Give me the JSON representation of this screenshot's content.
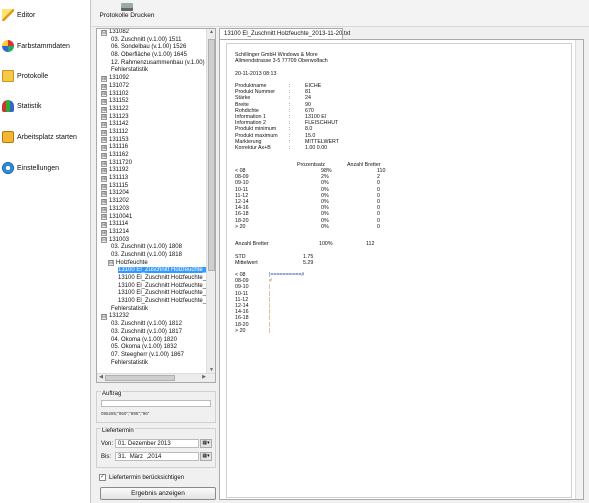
{
  "nav": {
    "items": [
      {
        "label": "Editor",
        "icon": "pencil-icon"
      },
      {
        "label": "Farbstammdaten",
        "icon": "palette-icon"
      },
      {
        "label": "Protokolle",
        "icon": "folder-icon"
      },
      {
        "label": "Statistik",
        "icon": "chart-icon"
      },
      {
        "label": "Arbeitsplatz starten",
        "icon": "briefcase-icon"
      },
      {
        "label": "Einstellungen",
        "icon": "settings-icon"
      }
    ]
  },
  "toolbar": {
    "print_label": "Protokolle Drucken",
    "print_icon": "printer-icon"
  },
  "tree": {
    "rows": [
      {
        "label": "131082",
        "exp": "⊟",
        "indent": 0
      },
      {
        "label": "03. Zuschnitt (v.1.00) 1511",
        "exp": "",
        "indent": 1
      },
      {
        "label": "06. Sondelbau (v.1.00) 1526",
        "exp": "",
        "indent": 1
      },
      {
        "label": "08. Oberfläche (v.1.00) 1645",
        "exp": "",
        "indent": 1
      },
      {
        "label": "12. Rahmenzusammenbau (v.1.00) 1",
        "exp": "",
        "indent": 1
      },
      {
        "label": "Fehlerstatistik",
        "exp": "",
        "indent": 1
      },
      {
        "label": "131092",
        "exp": "⊞",
        "indent": 0
      },
      {
        "label": "131072",
        "exp": "⊞",
        "indent": 0
      },
      {
        "label": "131102",
        "exp": "⊞",
        "indent": 0
      },
      {
        "label": "131152",
        "exp": "⊞",
        "indent": 0
      },
      {
        "label": "131122",
        "exp": "⊞",
        "indent": 0
      },
      {
        "label": "131123",
        "exp": "⊞",
        "indent": 0
      },
      {
        "label": "131142",
        "exp": "⊞",
        "indent": 0
      },
      {
        "label": "131112",
        "exp": "⊞",
        "indent": 0
      },
      {
        "label": "131153",
        "exp": "⊞",
        "indent": 0
      },
      {
        "label": "131116",
        "exp": "⊞",
        "indent": 0
      },
      {
        "label": "131162",
        "exp": "⊞",
        "indent": 0
      },
      {
        "label": "1311720",
        "exp": "⊞",
        "indent": 0
      },
      {
        "label": "131192",
        "exp": "⊞",
        "indent": 0
      },
      {
        "label": "131113",
        "exp": "⊞",
        "indent": 0
      },
      {
        "label": "131115",
        "exp": "⊞",
        "indent": 0
      },
      {
        "label": "131204",
        "exp": "⊞",
        "indent": 0
      },
      {
        "label": "131202",
        "exp": "⊞",
        "indent": 0
      },
      {
        "label": "131203",
        "exp": "⊞",
        "indent": 0
      },
      {
        "label": "1310041",
        "exp": "⊞",
        "indent": 0
      },
      {
        "label": "131114",
        "exp": "⊞",
        "indent": 0
      },
      {
        "label": "131214",
        "exp": "⊞",
        "indent": 0
      },
      {
        "label": "131003",
        "exp": "⊟",
        "indent": 0
      },
      {
        "label": "03. Zuschnitt (v.1.00) 1808",
        "exp": "",
        "indent": 1
      },
      {
        "label": "03. Zuschnitt (v.1.00) 1818",
        "exp": "",
        "indent": 1
      },
      {
        "label": "Holzfeuchte",
        "exp": "⊟",
        "indent": 1
      },
      {
        "label": "13100 El_Zuschnitt Holzfeuchte_",
        "exp": "",
        "indent": 2,
        "selected": true
      },
      {
        "label": "13100 El_Zuschnitt Holzfeuchte_",
        "exp": "",
        "indent": 2
      },
      {
        "label": "13100 El_Zuschnitt Holzfeuchte_",
        "exp": "",
        "indent": 2
      },
      {
        "label": "13100 El_Zuschnitt Holzfeuchte_",
        "exp": "",
        "indent": 2
      },
      {
        "label": "13100 El_Zuschnitt Holzfeuchte_",
        "exp": "",
        "indent": 2
      },
      {
        "label": "Fehlerstatistik",
        "exp": "",
        "indent": 1
      },
      {
        "label": "131232",
        "exp": "⊟",
        "indent": 0
      },
      {
        "label": "03. Zuschnitt (v.1.00) 1812",
        "exp": "",
        "indent": 1
      },
      {
        "label": "03. Zuschnitt (v.1.00) 1817",
        "exp": "",
        "indent": 1
      },
      {
        "label": "04. Okoma (v.1.00) 1820",
        "exp": "",
        "indent": 1
      },
      {
        "label": "05. Okoma (v.1.00) 1832",
        "exp": "",
        "indent": 1
      },
      {
        "label": "07. Steegherr (v.1.00) 1867",
        "exp": "",
        "indent": 1
      },
      {
        "label": "Fehlerstatistik",
        "exp": "",
        "indent": 1
      }
    ]
  },
  "auftrag": {
    "title": "Auftrag",
    "input_value": "",
    "value_text": "095285;\"950\";\"895\";\"96\""
  },
  "liefertermin": {
    "title": "Liefertermin",
    "von_label": "Von:",
    "von_day": "01.",
    "von_month": "Dezember",
    "von_year": "2013",
    "bis_label": "Bis:",
    "bis_day": "31.",
    "bis_month": "März",
    "bis_year": "2014"
  },
  "checkbox_label": "Liefertermin berücksichtigen",
  "checkbox_checked": true,
  "show_button_label": "Ergebnis anzeigen",
  "report": {
    "tab_label": "13100 El_Zuschnitt Holzfeuchte_2013-11-20.txt",
    "company": "Schillinger GmbH Windows & More",
    "address": "Allmendstrasse 3-5 77709 Oberwolfach",
    "datetime": "20-11-2013  08:13",
    "fields": [
      {
        "k": "Produktname",
        "v": "EICHE"
      },
      {
        "k": "Produkt Nummer",
        "v": "81"
      },
      {
        "k": "Stärke",
        "v": "24"
      },
      {
        "k": "Breite",
        "v": "90"
      },
      {
        "k": "Rohdichte",
        "v": "670"
      },
      {
        "k": "Information 1",
        "v": "13100 El"
      },
      {
        "k": "Information 2",
        "v": "FLEISCHHUT"
      },
      {
        "k": "Produkt minimum",
        "v": "8.0"
      },
      {
        "k": "Produkt maximum",
        "v": "15.0"
      },
      {
        "k": "Markierung",
        "v": "MITTELWERT"
      },
      {
        "k": "Korrektur Ax+B",
        "v": "1.00   0.00"
      }
    ],
    "table_headers": [
      "Prozentsatz",
      "Anzahl Bretter"
    ],
    "table_rows": [
      {
        "range": "< 08",
        "pct": "98%",
        "cnt": "110"
      },
      {
        "range": "08-09",
        "pct": "2%",
        "cnt": "2"
      },
      {
        "range": "09-10",
        "pct": "0%",
        "cnt": "0"
      },
      {
        "range": "10-11",
        "pct": "0%",
        "cnt": "0"
      },
      {
        "range": "11-12",
        "pct": "0%",
        "cnt": "0"
      },
      {
        "range": "12-14",
        "pct": "0%",
        "cnt": "0"
      },
      {
        "range": "14-16",
        "pct": "0%",
        "cnt": "0"
      },
      {
        "range": "16-18",
        "pct": "0%",
        "cnt": "0"
      },
      {
        "range": "18-20",
        "pct": "0%",
        "cnt": "0"
      },
      {
        "range": "> 20",
        "pct": "0%",
        "cnt": "0"
      }
    ],
    "anzahl_label": "Anzahl Bretter",
    "anzahl_pct": "100%",
    "anzahl_cnt": "112",
    "std_label": "STD",
    "std_value": "1.75",
    "mittel_label": "Mittelwert",
    "mittel_value": "5.29",
    "hist_rows": [
      {
        "range": "< 08",
        "bar": "|==========#"
      },
      {
        "range": "08-09",
        "bar": "#"
      },
      {
        "range": "09-10",
        "bar": "|"
      },
      {
        "range": "10-11",
        "bar": "|"
      },
      {
        "range": "11-12",
        "bar": "|"
      },
      {
        "range": "12-14",
        "bar": "|"
      },
      {
        "range": "14-16",
        "bar": "|"
      },
      {
        "range": "16-18",
        "bar": "|"
      },
      {
        "range": "18-20",
        "bar": "|"
      },
      {
        "range": "> 20",
        "bar": "|"
      }
    ]
  }
}
